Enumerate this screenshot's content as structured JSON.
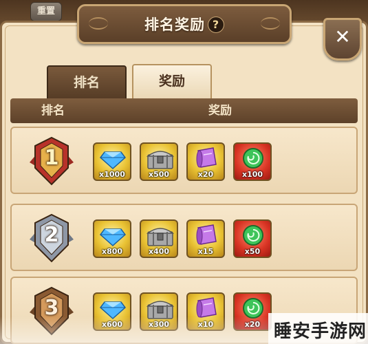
{
  "top": {
    "reset_label": "重置"
  },
  "dialog": {
    "title": "排名奖励",
    "help_glyph": "?",
    "close_glyph": "✕"
  },
  "tabs": [
    {
      "label": "排名",
      "active": false
    },
    {
      "label": "奖励",
      "active": true
    }
  ],
  "table": {
    "col_rank": "排名",
    "col_reward": "奖励"
  },
  "rows": [
    {
      "rank": "1",
      "medal": "gold-red-medal-icon",
      "rewards": [
        {
          "icon": "diamond-icon",
          "qty": "x1000"
        },
        {
          "icon": "treasure-chest-icon",
          "qty": "x500"
        },
        {
          "icon": "scroll-icon",
          "qty": "x20"
        },
        {
          "icon": "green-orb-icon",
          "qty": "x100"
        }
      ]
    },
    {
      "rank": "2",
      "medal": "silver-medal-icon",
      "rewards": [
        {
          "icon": "diamond-icon",
          "qty": "x800"
        },
        {
          "icon": "treasure-chest-icon",
          "qty": "x400"
        },
        {
          "icon": "scroll-icon",
          "qty": "x15"
        },
        {
          "icon": "green-orb-icon",
          "qty": "x50"
        }
      ]
    },
    {
      "rank": "3",
      "medal": "bronze-medal-icon",
      "rewards": [
        {
          "icon": "diamond-icon",
          "qty": "x600"
        },
        {
          "icon": "treasure-chest-icon",
          "qty": "x300"
        },
        {
          "icon": "scroll-icon",
          "qty": "x10"
        },
        {
          "icon": "green-orb-icon",
          "qty": "x20"
        }
      ]
    }
  ],
  "watermark": "睡安手游网",
  "colors": {
    "panel": "#f3e2c3",
    "header": "#6b4c30",
    "gold_slot": "#e9c233",
    "red_slot": "#d93424"
  }
}
